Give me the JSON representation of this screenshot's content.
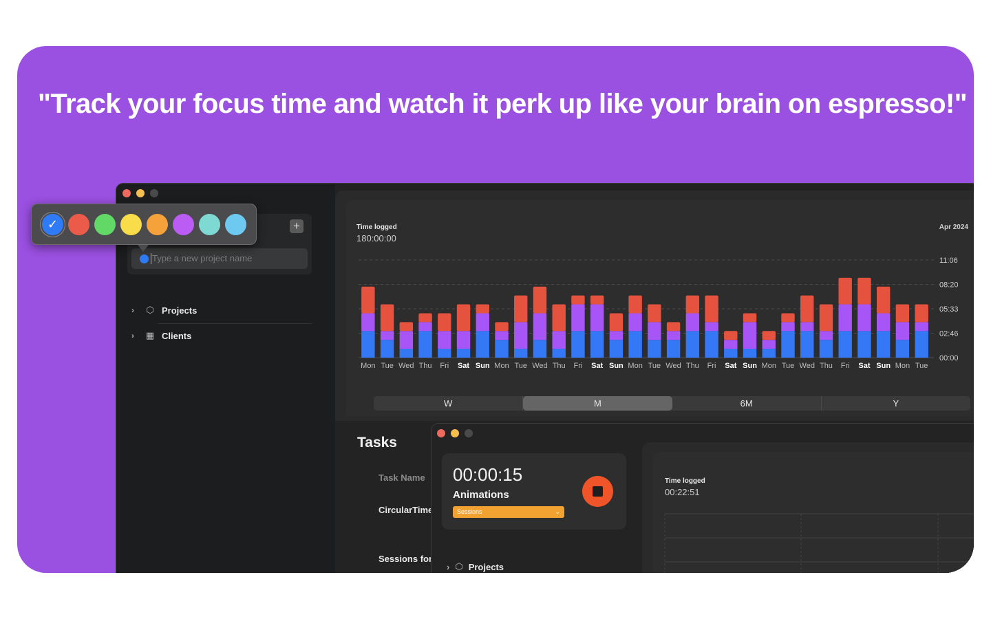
{
  "headline": "\"Track your focus time and watch it perk up like your brain on espresso!\"",
  "color_picker": {
    "swatches": [
      {
        "name": "blue",
        "color": "#2f7bf5",
        "selected": true
      },
      {
        "name": "red",
        "color": "#ec5a4a",
        "selected": false
      },
      {
        "name": "green",
        "color": "#62d867",
        "selected": false
      },
      {
        "name": "yellow",
        "color": "#f8dc4a",
        "selected": false
      },
      {
        "name": "orange",
        "color": "#f5a23a",
        "selected": false
      },
      {
        "name": "purple",
        "color": "#bb5cf5",
        "selected": false
      },
      {
        "name": "teal",
        "color": "#7ed9d2",
        "selected": false
      },
      {
        "name": "cyan",
        "color": "#6dc9ef",
        "selected": false
      }
    ],
    "check_icon": "checkmark-icon"
  },
  "sidebar": {
    "new_project_placeholder": "Type a new project name",
    "add_icon": "plus-icon",
    "items": [
      {
        "label": "Projects",
        "icon": "cube-icon"
      },
      {
        "label": "Clients",
        "icon": "building-icon"
      }
    ]
  },
  "chart": {
    "title": "Time logged",
    "total": "180:00:00",
    "period": "Apr 2024",
    "segments": [
      "W",
      "M",
      "6M",
      "Y"
    ],
    "selected_segment": "M"
  },
  "chart_data": {
    "type": "bar",
    "stacked": true,
    "y_tick_labels": [
      "00:00",
      "02:46",
      "05:33",
      "08:20",
      "11:06"
    ],
    "ylim_hours": [
      0,
      11.1
    ],
    "grid": "horizontal dashed",
    "categories": [
      "Mon",
      "Tue",
      "Wed",
      "Thu",
      "Fri",
      "Sat",
      "Sun",
      "Mon",
      "Tue",
      "Wed",
      "Thu",
      "Fri",
      "Sat",
      "Sun",
      "Mon",
      "Tue",
      "Wed",
      "Thu",
      "Fri",
      "Sat",
      "Sun",
      "Mon",
      "Tue",
      "Wed",
      "Thu",
      "Fri",
      "Sat",
      "Sun",
      "Mon",
      "Tue"
    ],
    "weekend_bold": [
      false,
      false,
      false,
      false,
      false,
      true,
      true,
      false,
      false,
      false,
      false,
      false,
      true,
      true,
      false,
      false,
      false,
      false,
      false,
      true,
      true,
      false,
      false,
      false,
      false,
      false,
      true,
      true,
      false,
      false
    ],
    "series": [
      {
        "color": "#3478f6",
        "values": [
          3,
          2,
          1,
          3,
          1,
          1,
          3,
          2,
          1,
          2,
          1,
          3,
          3,
          2,
          3,
          2,
          2,
          3,
          3,
          1,
          1,
          1,
          3,
          3,
          2,
          3,
          3,
          3,
          2,
          3
        ]
      },
      {
        "color": "#a855f7",
        "values": [
          2,
          1,
          2,
          1,
          2,
          2,
          2,
          1,
          3,
          3,
          2,
          3,
          3,
          1,
          2,
          2,
          1,
          2,
          1,
          1,
          3,
          1,
          1,
          1,
          1,
          3,
          3,
          2,
          2,
          1
        ]
      },
      {
        "color": "#e5533f",
        "values": [
          3,
          3,
          1,
          1,
          2,
          3,
          1,
          1,
          3,
          3,
          3,
          1,
          1,
          2,
          2,
          2,
          1,
          2,
          3,
          1,
          1,
          1,
          1,
          3,
          3,
          3,
          3,
          3,
          2,
          2
        ]
      }
    ]
  },
  "tasks": {
    "title": "Tasks",
    "column": "Task Name",
    "rows": [
      "CircularTime",
      "Sessions for"
    ]
  },
  "timer": {
    "elapsed": "00:00:15",
    "task": "Animations",
    "dropdown": "Sessions",
    "stop_icon": "stop-icon",
    "projects_label": "Projects"
  },
  "second_chart": {
    "title": "Time logged",
    "total": "00:22:51"
  }
}
